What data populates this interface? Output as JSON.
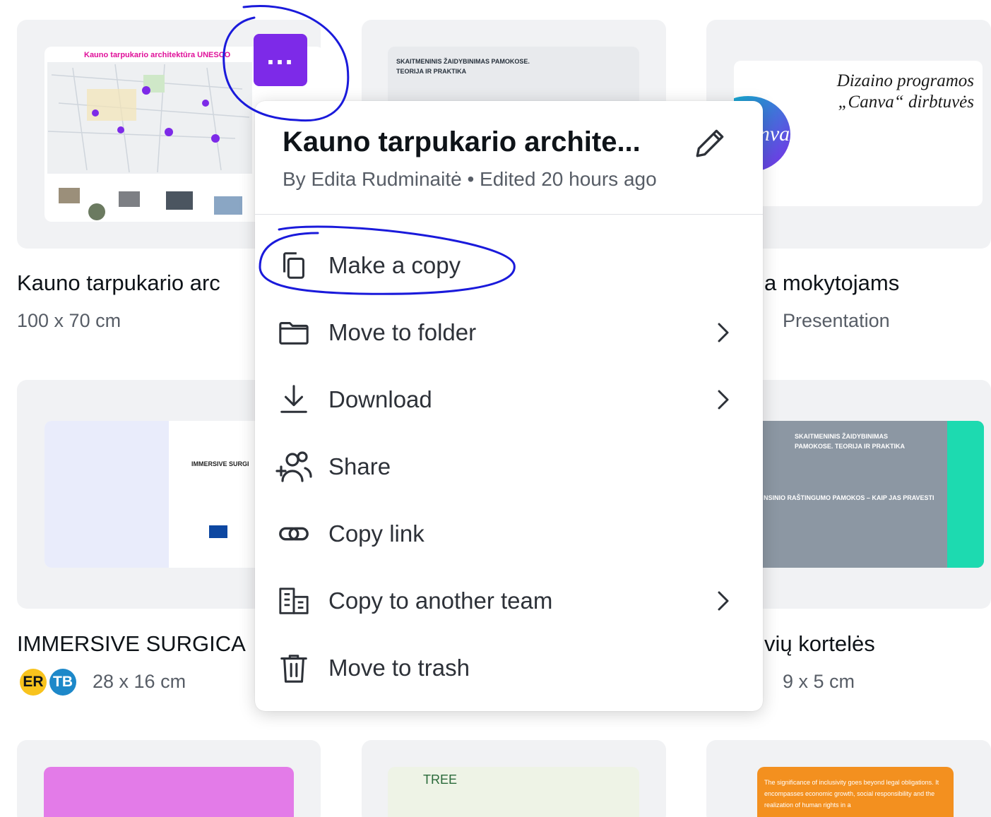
{
  "grid": {
    "row1": [
      {
        "title": "Kauno tarpukario arc",
        "meta": "100 x 70 cm",
        "thumb_heading": "Kauno tarpukario architektūra UNESCO"
      },
      {
        "title": "",
        "meta": "",
        "thumb_heading": "SKAITMENINIS ŽAIDYBINIMAS PAMOKOSE. TEORIJA IR PRAKTIKA"
      },
      {
        "title": "a mokytojams",
        "meta": "Presentation",
        "thumb_heading": "Dizaino programos „Canva“ dirbtuvės",
        "thumb_logo": "Canva"
      }
    ],
    "row2": [
      {
        "title": "IMMERSIVE SURGICA",
        "meta": "28 x 16 cm",
        "thumb_heading": "IMMERSIVE SURGI",
        "avatars": [
          "ER",
          "TB"
        ]
      },
      {
        "title": "",
        "meta": "",
        "thumb_heading": ""
      },
      {
        "title": "vių kortelės",
        "meta": "9 x 5 cm",
        "thumb_heading": "SKAITMENINIS ŽAIDYBINIMAS PAMOKOSE. TEORIJA IR PRAKTIKA",
        "thumb_sub": "NSINIO RAŠTINGUMO PAMOKOS – KAIP JAS PRAVESTI"
      }
    ],
    "row3": [
      {
        "thumb_heading": ""
      },
      {
        "thumb_heading": "TREE"
      },
      {
        "thumb_heading": "The significance of inclusivity goes beyond legal obligations. It encompasses economic growth, social responsibility and the realization of human rights in a"
      }
    ]
  },
  "more_button": {
    "label": "..."
  },
  "context_menu": {
    "title": "Kauno tarpukario archite...",
    "subtitle": "By Edita Rudminaitė • Edited 20 hours ago",
    "items": [
      {
        "label": "Make a copy",
        "icon": "copy-icon",
        "has_submenu": false
      },
      {
        "label": "Move to folder",
        "icon": "folder-icon",
        "has_submenu": true
      },
      {
        "label": "Download",
        "icon": "download-icon",
        "has_submenu": true
      },
      {
        "label": "Share",
        "icon": "share-icon",
        "has_submenu": false
      },
      {
        "label": "Copy link",
        "icon": "link-icon",
        "has_submenu": false
      },
      {
        "label": "Copy to another team",
        "icon": "team-icon",
        "has_submenu": true
      },
      {
        "label": "Move to trash",
        "icon": "trash-icon",
        "has_submenu": false
      }
    ]
  },
  "colors": {
    "accent": "#7d2ae8",
    "annotation": "#1a1adb",
    "card_bg": "#f1f2f4"
  }
}
